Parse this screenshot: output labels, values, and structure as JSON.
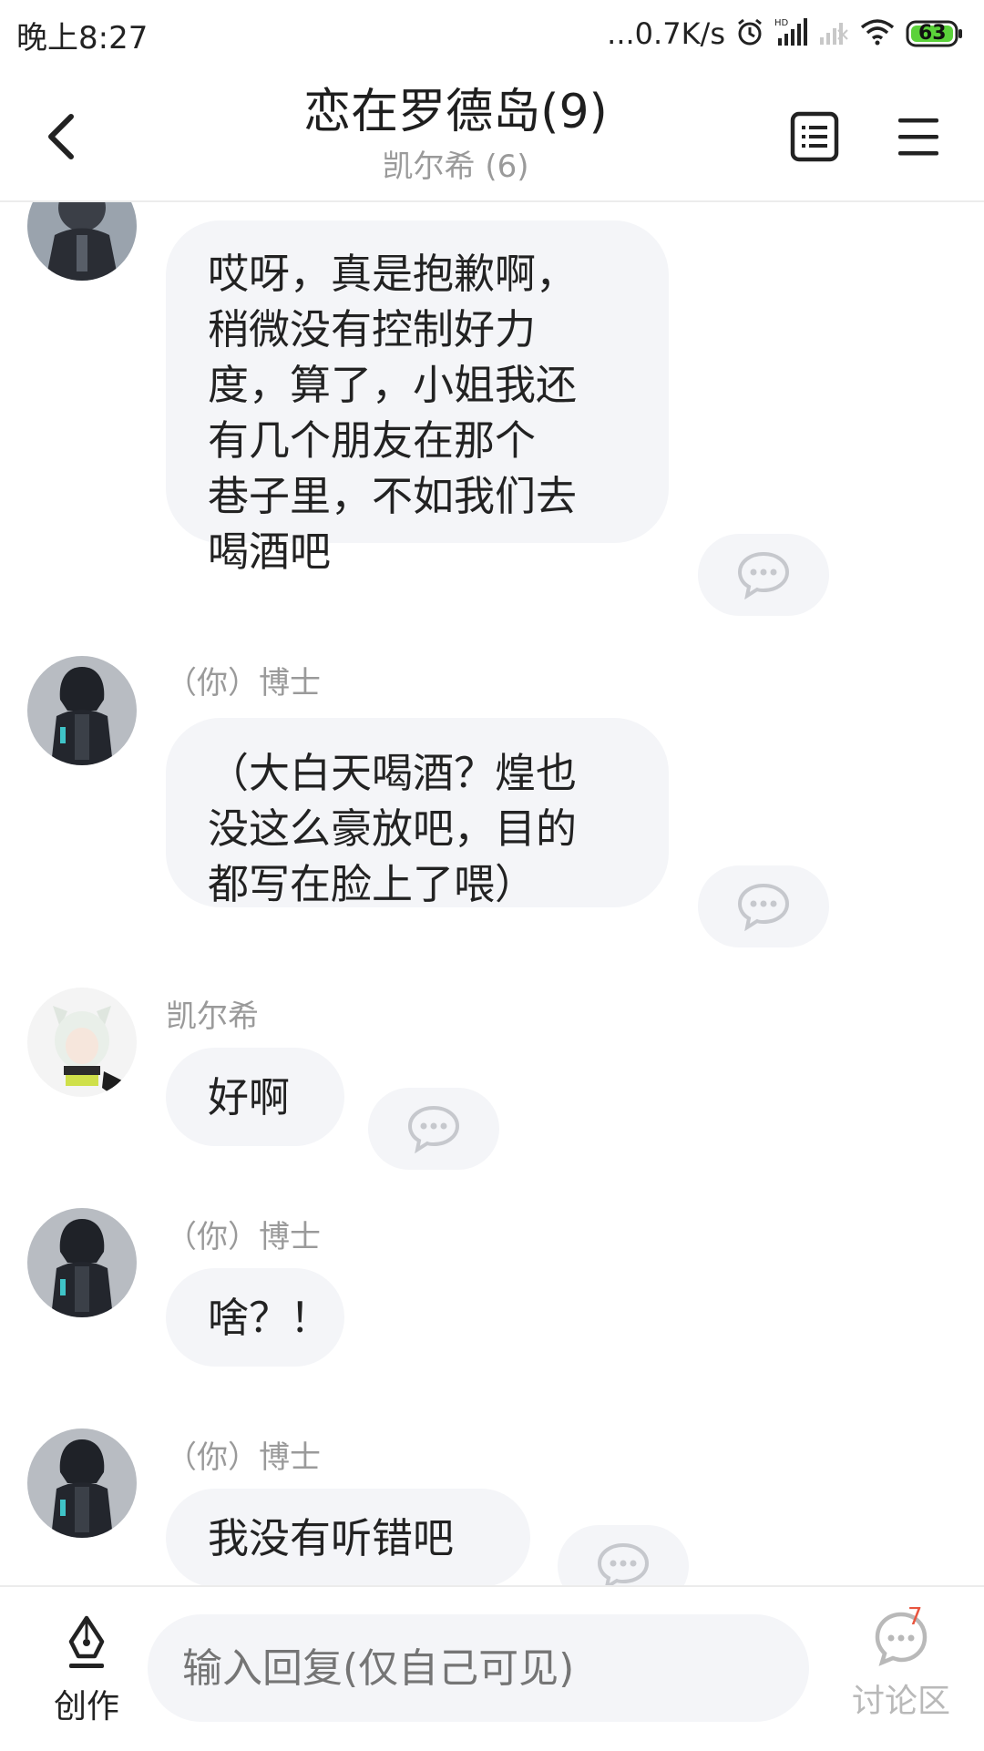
{
  "status_bar": {
    "time": "晚上8:27",
    "network_speed": "...0.7K/s",
    "battery_level": "63"
  },
  "header": {
    "title": "恋在罗德岛(9)",
    "subtitle": "凯尔希 (6)",
    "icons": [
      "back-icon",
      "list-icon",
      "menu-icon"
    ]
  },
  "messages": [
    {
      "sender": "",
      "avatar": "doctor-hooded",
      "lines": [
        "哎呀，真是抱歉啊，",
        "稍微没有控制好力",
        "度，算了，小姐我还",
        "有几个朋友在那个",
        "巷子里，不如我们去",
        "喝酒吧"
      ]
    },
    {
      "sender": "（你）博士",
      "avatar": "doctor-hooded",
      "lines": [
        "（大白天喝酒？煌也",
        "没这么豪放吧，目的",
        "都写在脸上了喂）"
      ]
    },
    {
      "sender": "凯尔希",
      "avatar": "kaltsit",
      "lines": [
        "好啊"
      ]
    },
    {
      "sender": "（你）博士",
      "avatar": "doctor-hooded",
      "lines": [
        "啥？！"
      ]
    },
    {
      "sender": "（你）博士",
      "avatar": "doctor-hooded",
      "lines": [
        "我没有听错吧"
      ]
    }
  ],
  "bottom_bar": {
    "create_label": "创作",
    "input_placeholder": "输入回复(仅自己可见)",
    "discuss_label": "讨论区",
    "discuss_count": "7"
  },
  "colors": {
    "bubble_bg": "#f4f5f8",
    "secondary_text": "#9a9a9a",
    "badge_red": "#e8553f",
    "battery_green": "#5bd23a"
  }
}
